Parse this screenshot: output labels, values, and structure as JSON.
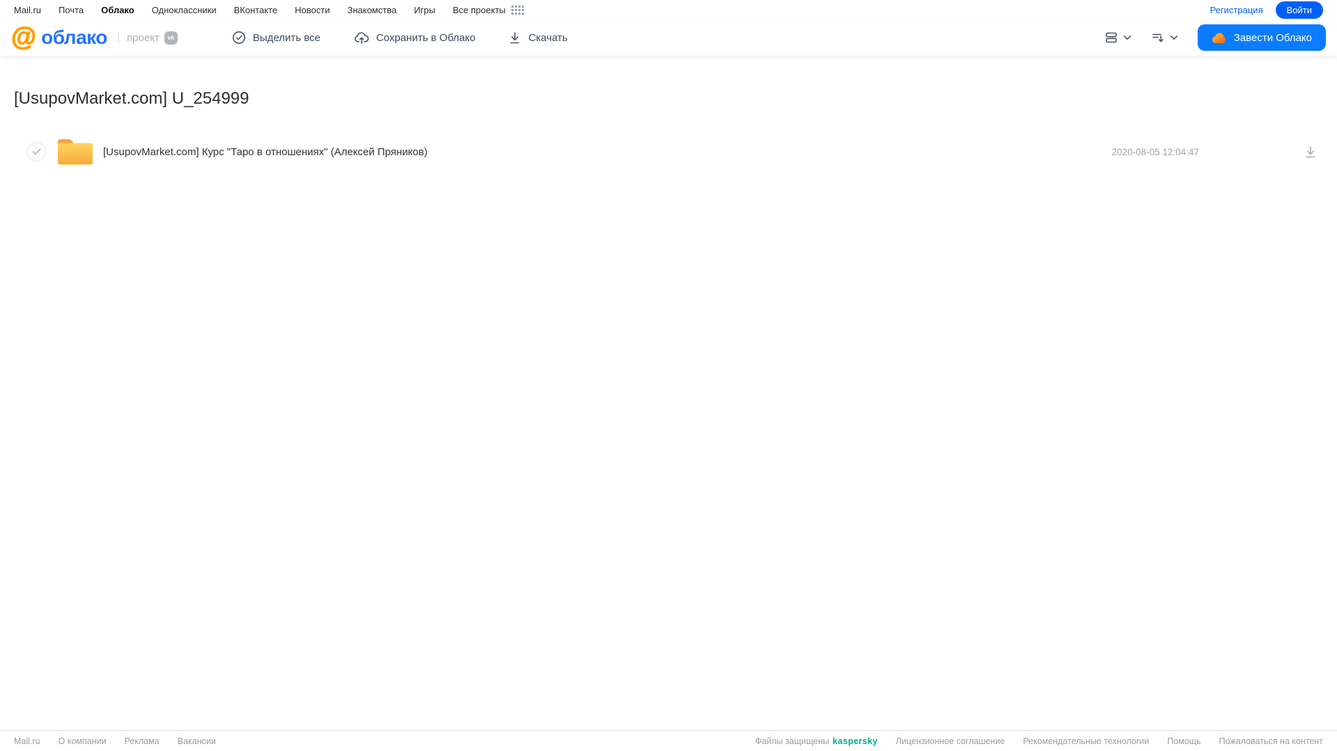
{
  "portal_nav": {
    "links": [
      "Mail.ru",
      "Почта",
      "Облако",
      "Одноклассники",
      "ВКонтакте",
      "Новости",
      "Знакомства",
      "Игры"
    ],
    "active_link": "Облако",
    "all_projects_label": "Все проекты",
    "register_label": "Регистрация",
    "login_label": "Войти"
  },
  "header": {
    "logo_at": "@",
    "logo_text": "облако",
    "logo_separator": "|",
    "project_label": "проект",
    "vk_badge": "vk",
    "toolbar": {
      "select_all_label": "Выделить все",
      "save_to_cloud_label": "Сохранить в Облако",
      "download_label": "Скачать"
    },
    "get_cloud_button_label": "Завести Облако"
  },
  "main": {
    "title": "[UsupovMarket.com] U_254999",
    "files": [
      {
        "type": "folder",
        "name": "[UsupovMarket.com] Курс \"Таро в отношениях\" (Алексей Пряников)",
        "date": "2020-08-05 12:04:47"
      }
    ]
  },
  "footer": {
    "left_links": [
      "Mail.ru",
      "О компании",
      "Реклама",
      "Вакансии"
    ],
    "protected_label": "Файлы защищены",
    "kaspersky_label": "kaspersky",
    "right_links": [
      "Лицензионное соглашение",
      "Рекомендательные технологии",
      "Помощь",
      "Пожаловаться на контент"
    ]
  },
  "icons": {
    "apps_grid": "grid-dots-icon",
    "select_all": "circle-check-icon",
    "save_to_cloud": "cloud-upload-icon",
    "download": "download-arrow-icon",
    "view_mode": "list-view-icon",
    "sort": "sort-lines-icon",
    "chevron": "chevron-down-icon",
    "folder": "yellow-folder-icon",
    "button_cloud": "orange-cloud-icon"
  },
  "colors": {
    "accent_blue": "#005ff9",
    "button_blue": "#0b7cff",
    "logo_blue": "#2775ff",
    "logo_orange": "#ff9e00",
    "folder_yellow_top": "#ffd462",
    "folder_yellow_bottom": "#f5ac3c",
    "kaspersky_teal": "#00a88e",
    "muted_gray": "#a5a5a5"
  }
}
